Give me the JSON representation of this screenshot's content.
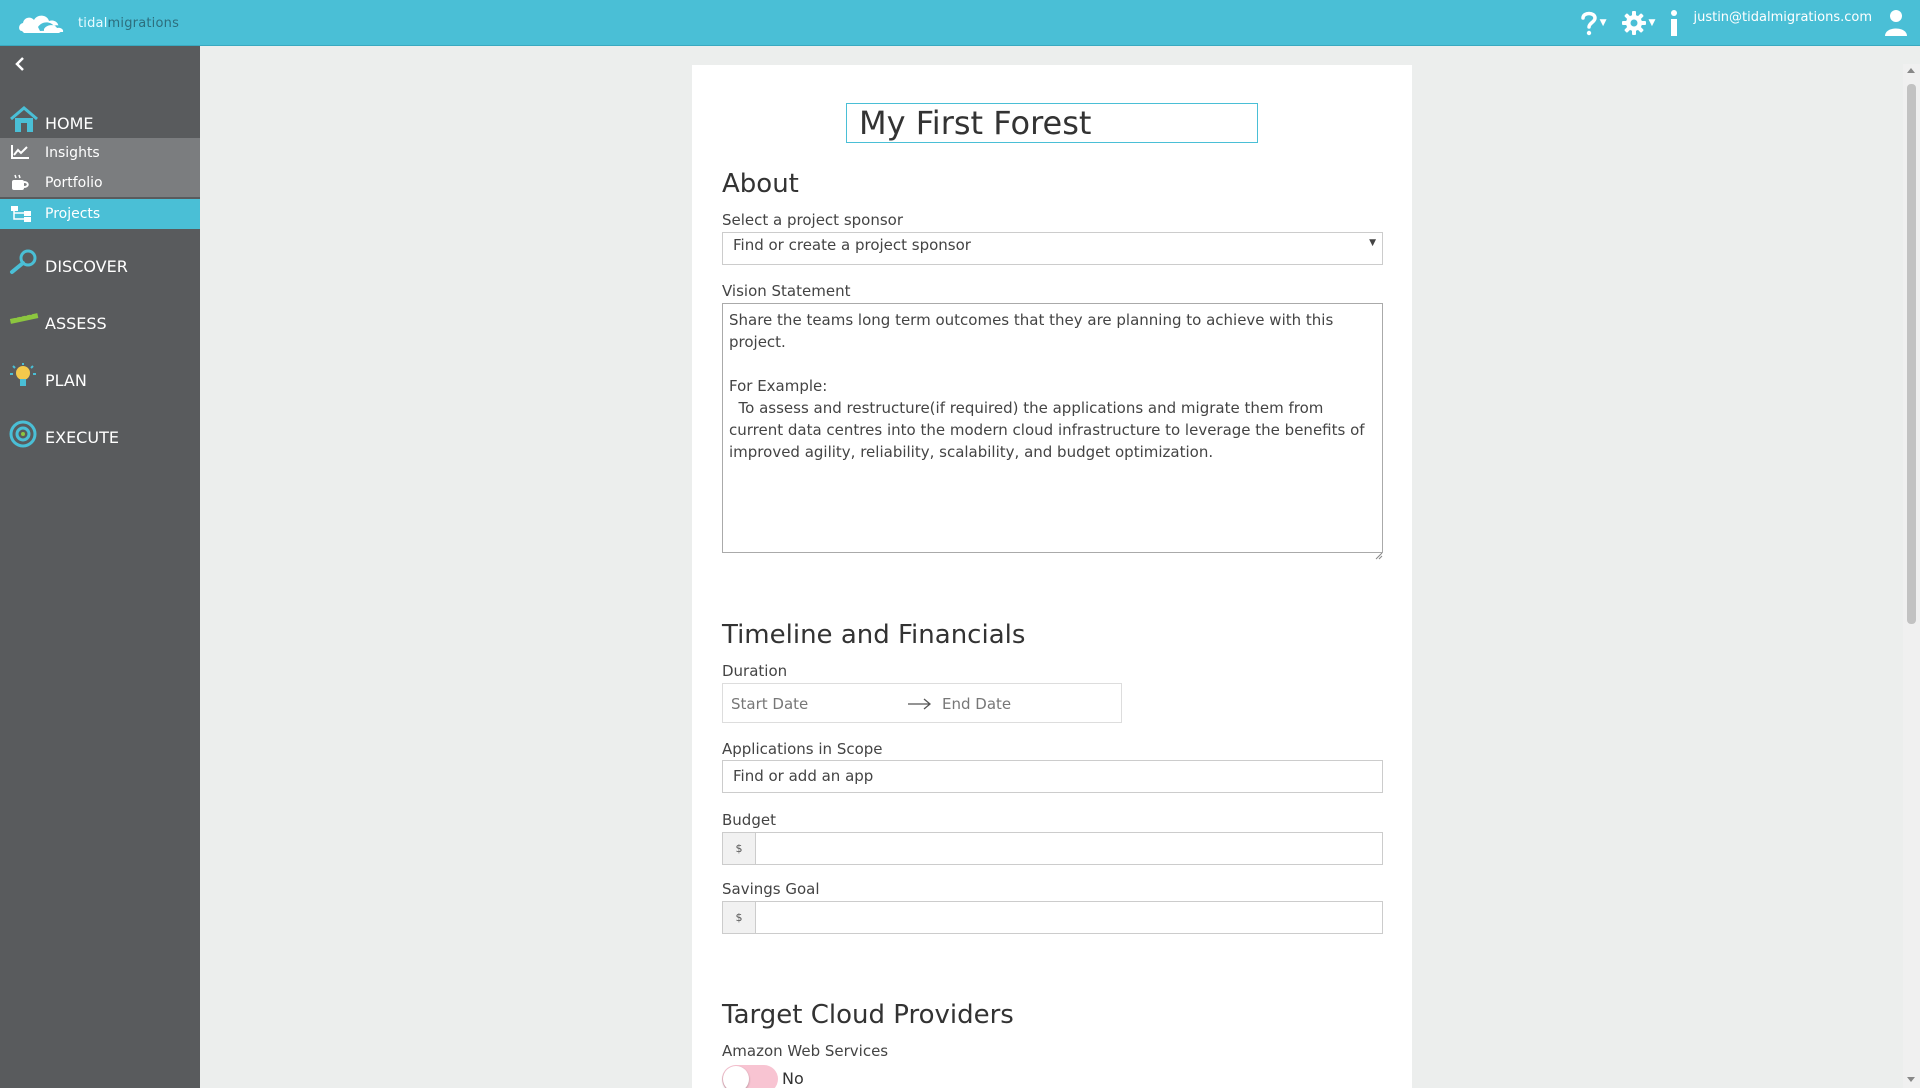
{
  "topbar": {
    "logo_word_1": "tidal",
    "logo_word_2": "migrations",
    "user_email": "justin@tidalmigrations.com"
  },
  "sidebar": {
    "home": "HOME",
    "sub_items": [
      "Insights",
      "Portfolio",
      "Projects"
    ],
    "active_sub": "Projects",
    "main_items": [
      "DISCOVER",
      "ASSESS",
      "PLAN",
      "EXECUTE"
    ]
  },
  "project": {
    "name": "My First Forest"
  },
  "about": {
    "heading": "About",
    "sponsor_label": "Select a project sponsor",
    "sponsor_placeholder": "Find or create a project sponsor",
    "vision_label": "Vision Statement",
    "vision_placeholder": "Share the teams long term outcomes that they are planning to achieve with this project.\n\nFor Example:\n  To assess and restructure(if required) the applications and migrate them from current data centres into the modern cloud infrastructure to leverage the benefits of improved agility, reliability, scalability, and budget optimization."
  },
  "timeline": {
    "heading": "Timeline and Financials",
    "duration_label": "Duration",
    "start_placeholder": "Start Date",
    "end_placeholder": "End Date",
    "apps_label": "Applications in Scope",
    "apps_placeholder": "Find or add an app",
    "budget_label": "Budget",
    "currency_symbol": "$",
    "budget_value": "",
    "savings_label": "Savings Goal",
    "savings_value": ""
  },
  "cloud": {
    "heading": "Target Cloud Providers",
    "provider_1": "Amazon Web Services",
    "provider_1_state": "No"
  },
  "colors": {
    "topbar": "#4abfd6",
    "sidebar": "#595b5d",
    "active": "#4abfd6",
    "toggle_off": "#f8c4d2"
  }
}
